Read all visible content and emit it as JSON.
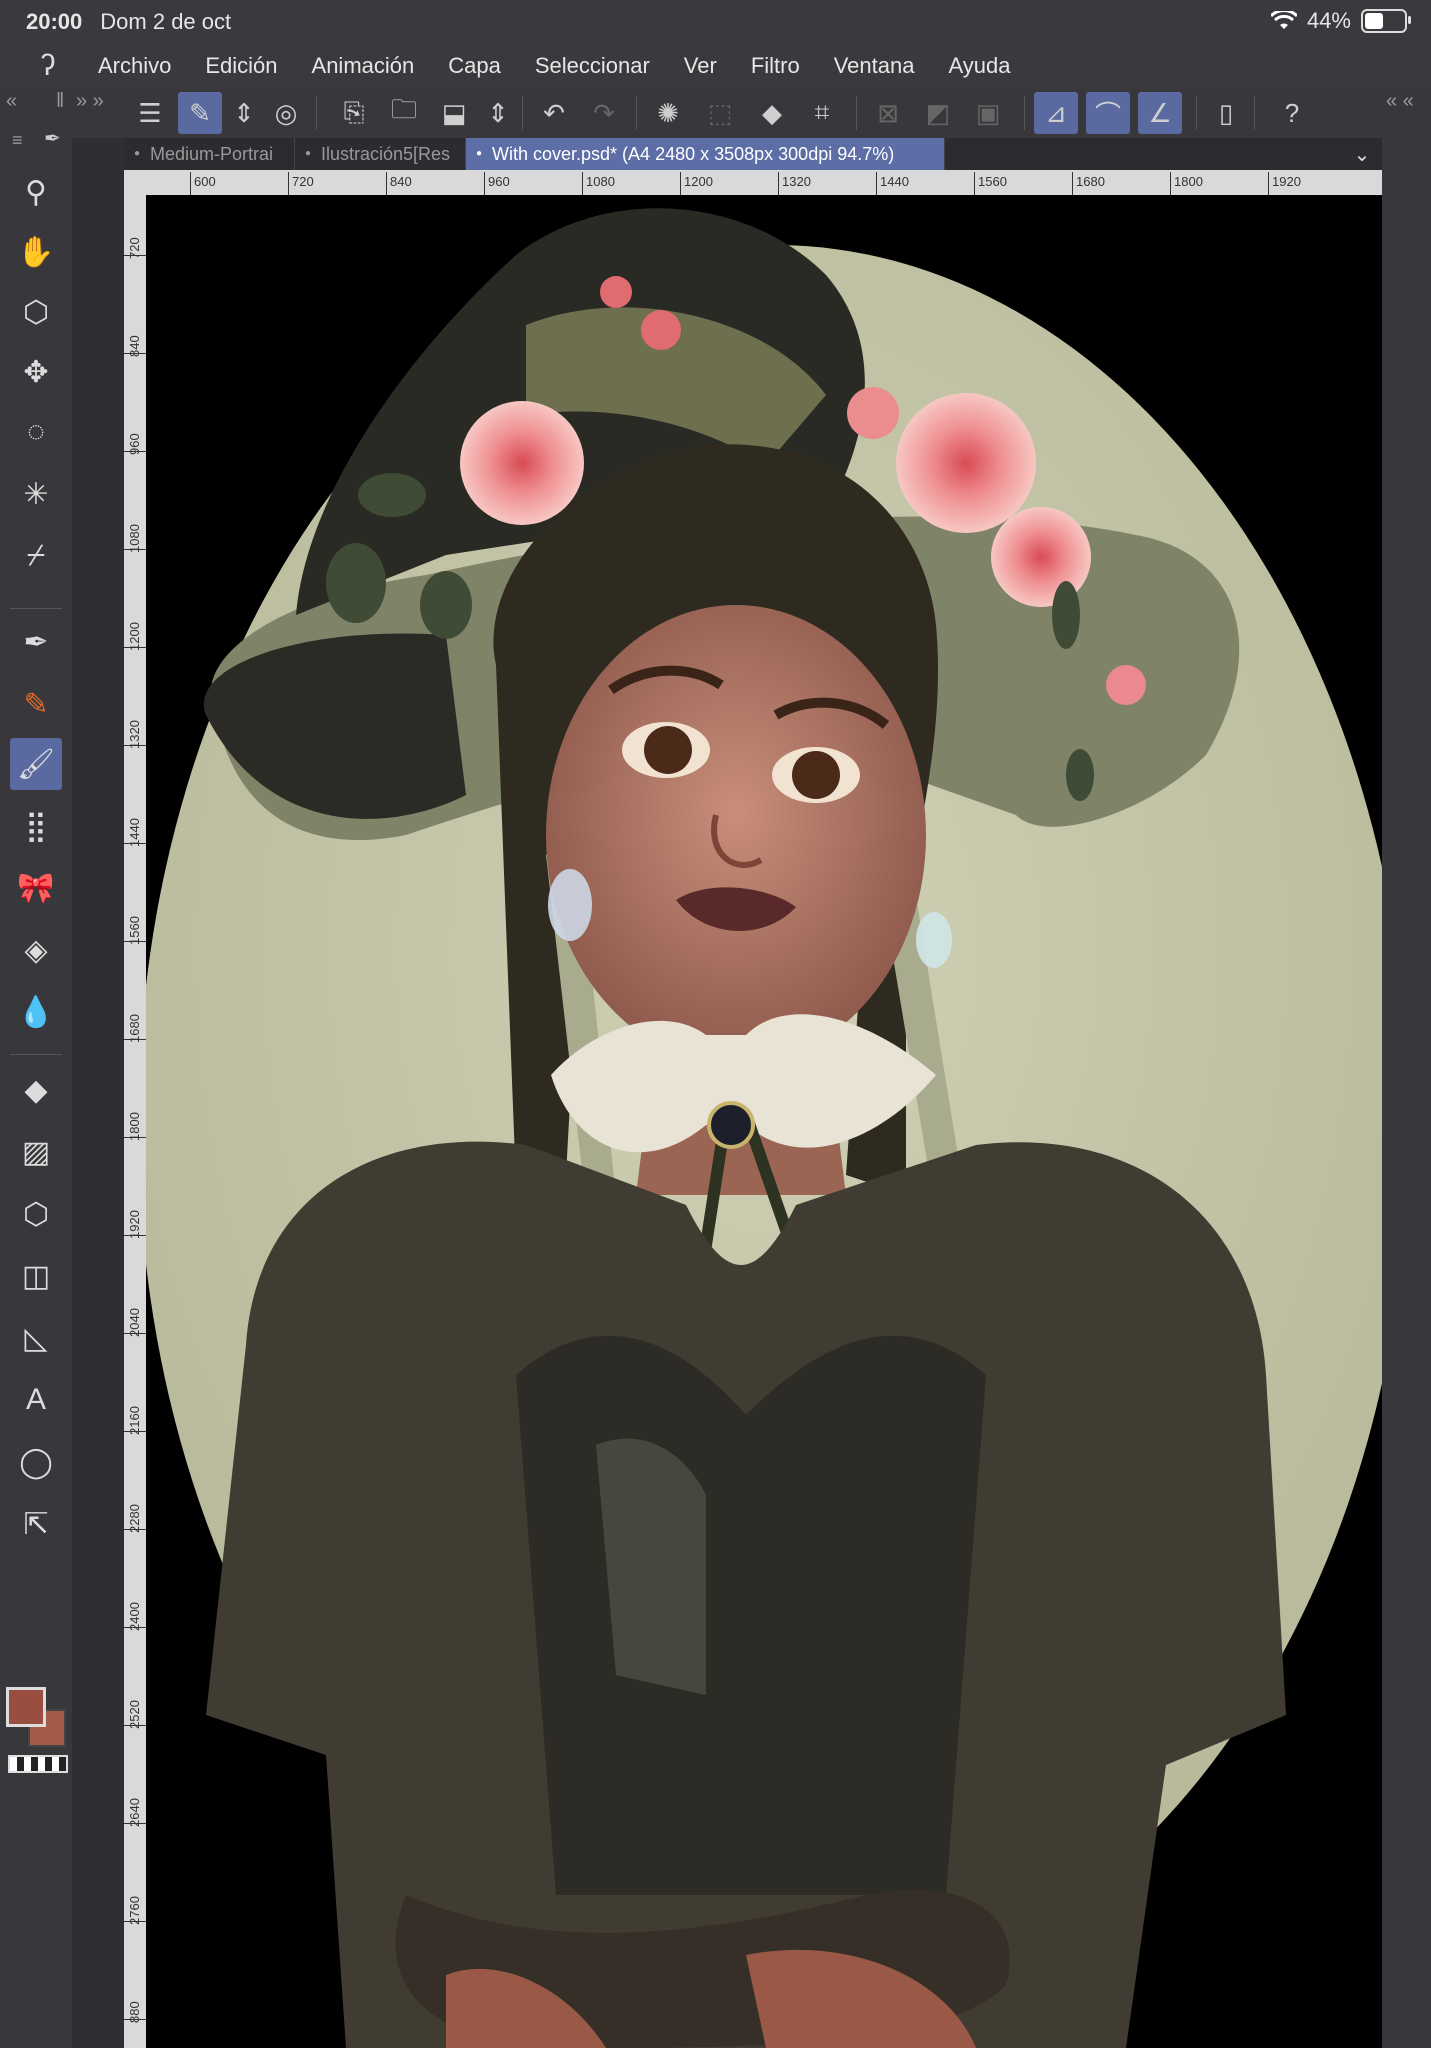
{
  "status": {
    "time": "20:00",
    "date": "Dom 2 de oct",
    "battery": "44%"
  },
  "menu": [
    "Archivo",
    "Edición",
    "Animación",
    "Capa",
    "Seleccionar",
    "Ver",
    "Filtro",
    "Ventana",
    "Ayuda"
  ],
  "tabs": [
    {
      "label": "Medium-Portrai"
    },
    {
      "label": "Ilustración5[Res"
    },
    {
      "label": "With cover.psd* (A4 2480 x 3508px 300dpi 94.7%)"
    }
  ],
  "ruler": {
    "top": [
      "600",
      "720",
      "840",
      "960",
      "1080",
      "1200",
      "1320",
      "1440",
      "1560",
      "1680",
      "1800",
      "1920"
    ],
    "left": [
      "720",
      "840",
      "960",
      "1080",
      "1200",
      "1320",
      "1440",
      "1560",
      "1680",
      "1800",
      "1920",
      "2040",
      "2160",
      "2280",
      "2400",
      "2520",
      "2640",
      "2760",
      "880"
    ]
  },
  "colors": {
    "main": "#9a4e42",
    "sub": "#a55a4a",
    "accent": "#5a6aa0"
  }
}
